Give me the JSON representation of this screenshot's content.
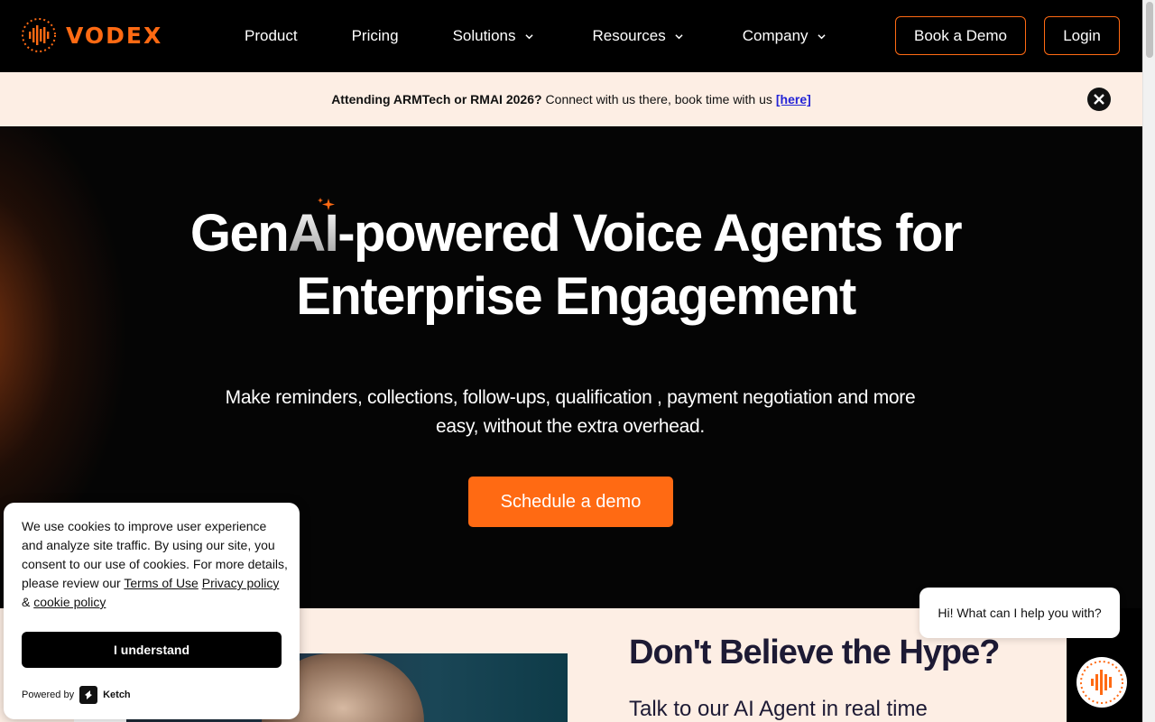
{
  "brand": {
    "name": "VODEX",
    "accent": "#ff6a13"
  },
  "nav": {
    "items": [
      {
        "label": "Product",
        "has_dropdown": false
      },
      {
        "label": "Pricing",
        "has_dropdown": false
      },
      {
        "label": "Solutions",
        "has_dropdown": true
      },
      {
        "label": "Resources",
        "has_dropdown": true
      },
      {
        "label": "Company",
        "has_dropdown": true
      }
    ],
    "book_demo": "Book a Demo",
    "login": "Login"
  },
  "announcement": {
    "bold": "Attending ARMTech or RMAI 2026?",
    "text": "Connect with us there, book time with us",
    "link": "[here]",
    "close_icon": "close-icon"
  },
  "hero": {
    "title_part1": "Gen",
    "title_ai": "AI",
    "title_part2": "-powered Voice Agents for",
    "title_line2": "Enterprise Engagement",
    "subtitle": "Make reminders, collections, follow-ups, qualification , payment negotiation and more easy, without the extra overhead.",
    "cta": "Schedule a demo"
  },
  "section": {
    "title": "Don't Believe the Hype?",
    "subtitle": "Talk to our AI Agent in real time"
  },
  "cookie": {
    "text": "We use cookies to improve user experience and analyze site traffic. By using our site, you consent to our use of cookies. For more details, please review our",
    "terms": "Terms of Use",
    "privacy": "Privacy policy",
    "amp": "&",
    "cookie_policy": "cookie policy",
    "button": "I understand",
    "powered_by": "Powered by",
    "powered_name": "Ketch"
  },
  "chat": {
    "greeting": "Hi! What can I help you with?"
  }
}
